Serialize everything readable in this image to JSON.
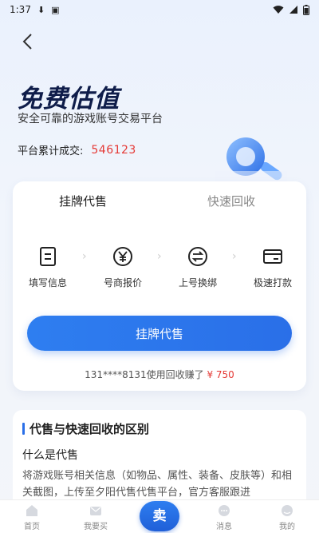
{
  "status": {
    "time": "1:37"
  },
  "hero": {
    "title": "免费估值",
    "subtitle": "安全可靠的游戏账号交易平台",
    "deal_label": "平台累计成交:",
    "deal_value": "546123"
  },
  "card": {
    "tabs": [
      "挂牌代售",
      "快速回收"
    ],
    "steps": [
      {
        "icon": "form-icon",
        "label": "填写信息"
      },
      {
        "icon": "yen-icon",
        "label": "号商报价"
      },
      {
        "icon": "swap-icon",
        "label": "上号换绑"
      },
      {
        "icon": "card-icon",
        "label": "极速打款"
      }
    ],
    "cta_label": "挂牌代售",
    "earn_text": "131****8131使用回收赚了",
    "earn_amount": "¥ 750"
  },
  "section": {
    "title": "代售与快速回收的区别",
    "question": "什么是代售",
    "paragraph": "将游戏账号相关信息（如物品、属性、装备、皮肤等）和相关截图，上传至夕阳代售代售平台，官方客服跟进"
  },
  "tabbar": {
    "items": [
      "首页",
      "我要买",
      "卖",
      "消息",
      "我的"
    ]
  },
  "colors": {
    "accent": "#2a6fe8",
    "price": "#e53935",
    "title": "#0f1d4a"
  }
}
